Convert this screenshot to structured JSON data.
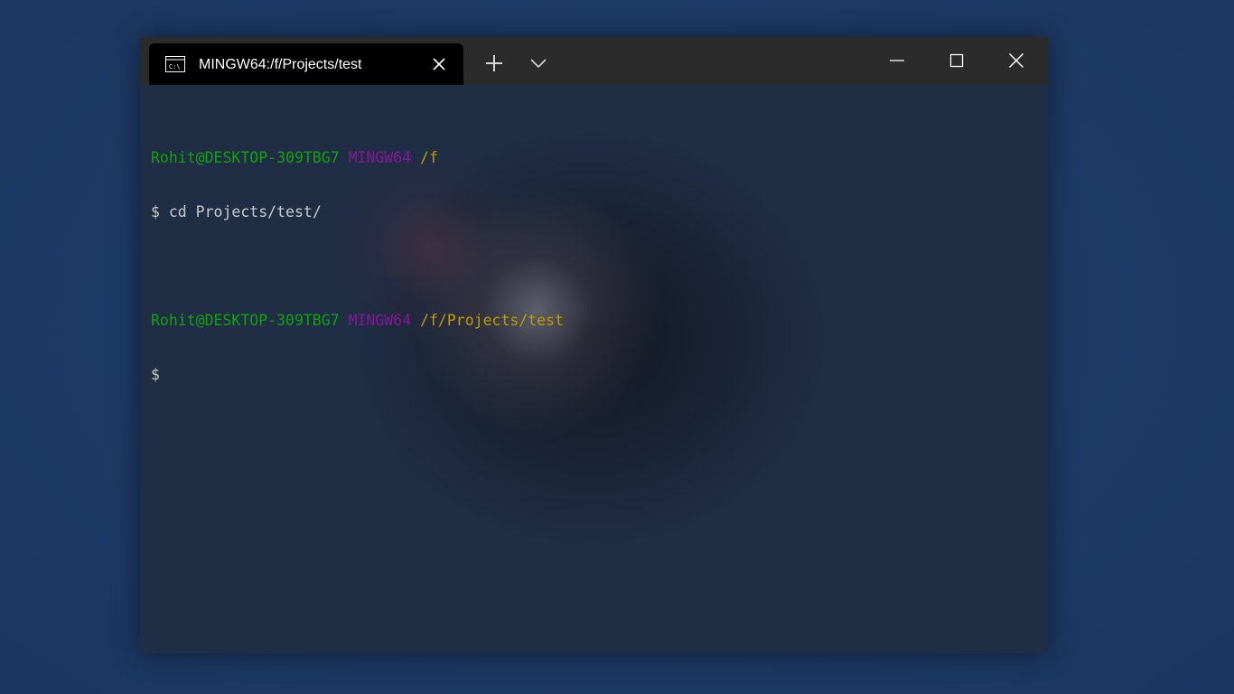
{
  "window": {
    "tab": {
      "title": "MINGW64:/f/Projects/test",
      "icon": "terminal-icon"
    },
    "buttons": {
      "new_tab_icon": "plus-icon",
      "dropdown_icon": "chevron-down-icon",
      "minimize_icon": "minimize-icon",
      "maximize_icon": "maximize-icon",
      "close_icon": "close-icon"
    }
  },
  "terminal": {
    "lines": [
      {
        "user": "Rohit@DESKTOP-309TBG7",
        "host": "MINGW64",
        "path": "/f"
      },
      {
        "prompt": "$",
        "command": "cd Projects/test/"
      },
      {
        "user": "Rohit@DESKTOP-309TBG7",
        "host": "MINGW64",
        "path": "/f/Projects/test"
      },
      {
        "prompt": "$",
        "command": ""
      }
    ]
  },
  "colors": {
    "user": "#13a10e",
    "host": "#881798",
    "path": "#c19c00",
    "text": "#cccccc",
    "tab_bg": "#000000",
    "titlebar_bg": "#2b2b2b"
  }
}
